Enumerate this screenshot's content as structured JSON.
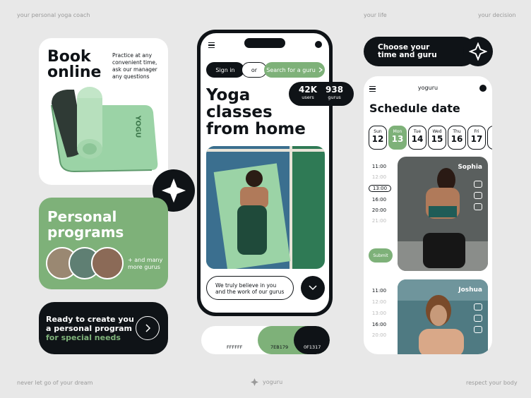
{
  "corners": {
    "top_left": "your personal yoga coach",
    "top_mid": "your life",
    "top_right": "your decision",
    "bottom_left": "never let go of your dream",
    "bottom_mid": "yoguru",
    "bottom_right": "respect your body"
  },
  "book_card": {
    "title_line1": "Book",
    "title_line2": "online",
    "desc_line1": "Practice at any",
    "desc_line2": "convenient time,",
    "desc_line3": "ask our manager",
    "desc_line4": "any questions",
    "mat_brand": "YOGU"
  },
  "programs_card": {
    "title_line1": "Personal",
    "title_line2": "programs",
    "more_line1": "+ and many",
    "more_line2": "more gurus"
  },
  "ready_card": {
    "line1": "Ready to create you",
    "line2": "a personal program",
    "line3": "for special needs"
  },
  "phone": {
    "sign_in": "Sign in",
    "or": "or",
    "search_guru": "Search for a guru",
    "headline_line1": "Yoga",
    "headline_line2": "classes",
    "headline_line3": "from home",
    "believe_line1": "We truly believe in you",
    "believe_line2": "and the work of our gurus"
  },
  "stats": {
    "users_value": "42K",
    "users_label": "users",
    "gurus_value": "938",
    "gurus_label": "gurus"
  },
  "palette": {
    "c1": "FFFFFF",
    "c2": "7EB179",
    "c3": "0F1317"
  },
  "choose_pill": {
    "line1": "Choose your",
    "line2": "time and guru"
  },
  "schedule": {
    "app_name": "yoguru",
    "title": "Schedule date",
    "days": [
      {
        "name": "Sun",
        "num": "12"
      },
      {
        "name": "Mon",
        "num": "13"
      },
      {
        "name": "Tue",
        "num": "14"
      },
      {
        "name": "Wed",
        "num": "15"
      },
      {
        "name": "Thu",
        "num": "16"
      },
      {
        "name": "Fri",
        "num": "17"
      }
    ],
    "times_a": [
      "11:00",
      "12:00",
      "13:00",
      "16:00",
      "20:00",
      "21:00"
    ],
    "times_b": [
      "11:00",
      "12:00",
      "13:00",
      "16:00",
      "20:00"
    ],
    "submit": "Submit",
    "guru1": "Sophia",
    "guru2": "Joshua"
  },
  "colors": {
    "white": "#ffffff",
    "green": "#7eb179",
    "dark": "#0f1317",
    "bg": "#e8e8e8"
  }
}
